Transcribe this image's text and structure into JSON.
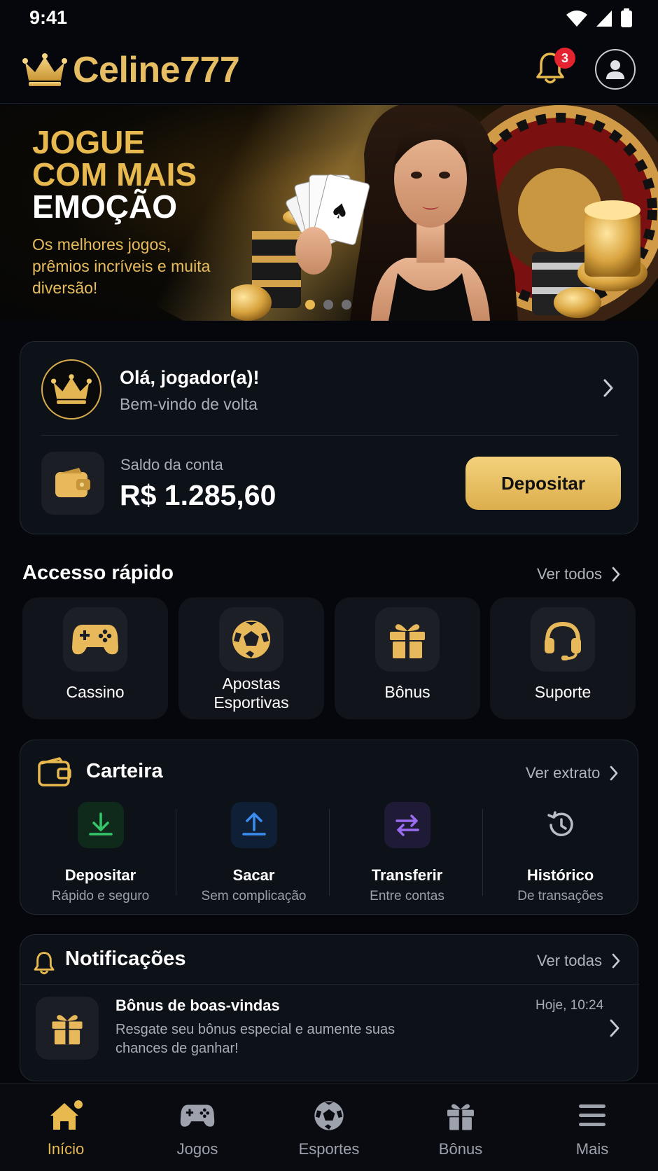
{
  "status_bar": {
    "time": "9:41"
  },
  "header": {
    "brand": "Celine777",
    "notification_count": "3"
  },
  "banner": {
    "title_line1": "JOGUE",
    "title_line2": "COM MAIS",
    "title_line3": "EMOÇÃO",
    "subtitle": "Os melhores jogos, prêmios incríveis e muita diversão!",
    "slide_count": 3,
    "active_slide": 1
  },
  "welcome": {
    "greeting": "Olá, jogador(a)!",
    "subtitle": "Bem-vindo de volta",
    "balance_label": "Saldo da conta",
    "balance_value": "R$ 1.285,60",
    "deposit_label": "Depositar"
  },
  "quick_access": {
    "title": "Accesso rápido",
    "see_all": "Ver todos",
    "items": [
      {
        "label": "Cassino",
        "icon": "gamepad-icon"
      },
      {
        "label": "Apostas Esportivas",
        "line1": "Apostas",
        "line2": "Esportivas",
        "icon": "soccer-ball-icon"
      },
      {
        "label": "Bônus",
        "icon": "gift-icon"
      },
      {
        "label": "Suporte",
        "icon": "headset-icon"
      }
    ]
  },
  "wallet": {
    "title": "Carteira",
    "link": "Ver extrato",
    "actions": [
      {
        "title": "Depositar",
        "subtitle": "Rápido e seguro",
        "icon": "download-icon",
        "color": "#35c56a"
      },
      {
        "title": "Sacar",
        "subtitle": "Sem complicação",
        "icon": "upload-icon",
        "color": "#3b8df0"
      },
      {
        "title": "Transferir",
        "subtitle": "Entre contas",
        "icon": "transfer-icon",
        "color": "#9a6cf0"
      },
      {
        "title": "Histórico",
        "subtitle": "De transações",
        "icon": "history-icon",
        "color": "#b7bcc5"
      }
    ]
  },
  "notifications": {
    "title": "Notificações",
    "link": "Ver todas",
    "items": [
      {
        "title": "Bônus de boas-vindas",
        "time": "Hoje, 10:24",
        "body": "Resgate seu bônus especial e aumente suas chances de ganhar!"
      }
    ]
  },
  "bottom_nav": {
    "items": [
      {
        "label": "Início",
        "icon": "home-icon",
        "active": true
      },
      {
        "label": "Jogos",
        "icon": "gamepad-icon",
        "active": false
      },
      {
        "label": "Esportes",
        "icon": "soccer-ball-icon",
        "active": false
      },
      {
        "label": "Bônus",
        "icon": "gift-icon",
        "active": false
      },
      {
        "label": "Mais",
        "icon": "menu-icon",
        "active": false
      }
    ]
  },
  "colors": {
    "accent_gold": "#e7b94e",
    "background": "#05070c",
    "card": "#0d1118",
    "badge_red": "#e3232f"
  }
}
